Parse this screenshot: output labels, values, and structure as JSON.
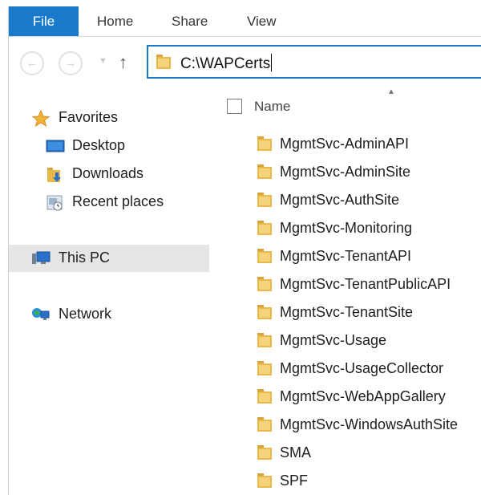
{
  "ribbon": {
    "tabs": [
      "File",
      "Home",
      "Share",
      "View"
    ]
  },
  "address": {
    "path": "C:\\WAPCerts"
  },
  "navpane": {
    "favorites": "Favorites",
    "desktop": "Desktop",
    "downloads": "Downloads",
    "recent": "Recent places",
    "thispc": "This PC",
    "network": "Network"
  },
  "list": {
    "column_name": "Name",
    "items": [
      "MgmtSvc-AdminAPI",
      "MgmtSvc-AdminSite",
      "MgmtSvc-AuthSite",
      "MgmtSvc-Monitoring",
      "MgmtSvc-TenantAPI",
      "MgmtSvc-TenantPublicAPI",
      "MgmtSvc-TenantSite",
      "MgmtSvc-Usage",
      "MgmtSvc-UsageCollector",
      "MgmtSvc-WebAppGallery",
      "MgmtSvc-WindowsAuthSite",
      "SMA",
      "SPF"
    ]
  },
  "colors": {
    "accent": "#1979ca",
    "folder": "#e8b84a",
    "selection": "#e6e6e6"
  }
}
